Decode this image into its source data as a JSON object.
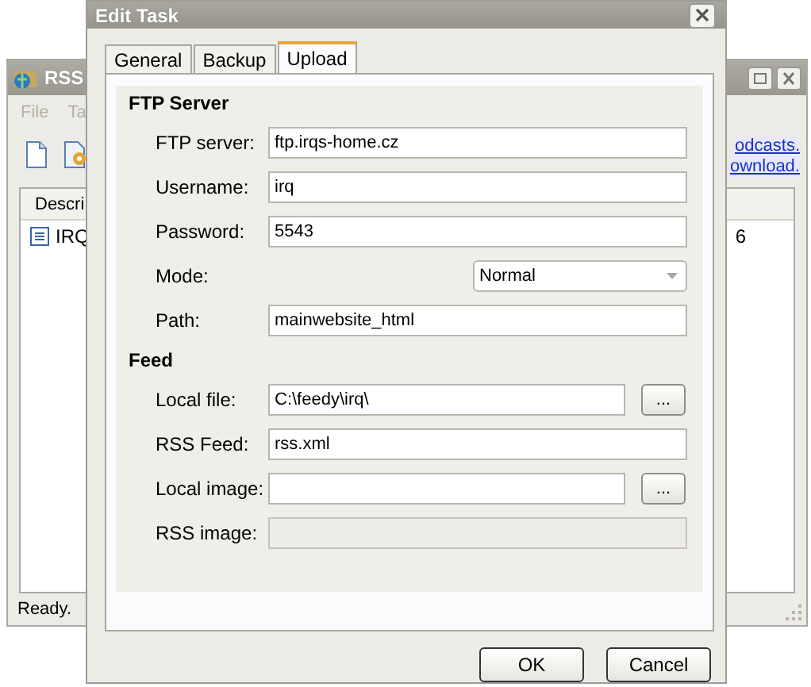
{
  "background_window": {
    "title": "RSS",
    "menu": [
      "File",
      "Ta"
    ],
    "links": [
      "odcasts.",
      "ownload."
    ],
    "columns": [
      "Descri"
    ],
    "rows": [
      {
        "column_1": "IRQ",
        "column_2": "6"
      }
    ],
    "status_bar": "Ready."
  },
  "dialog": {
    "title": "Edit Task",
    "tabs": [
      {
        "label": "General",
        "selected": false
      },
      {
        "label": "Backup",
        "selected": false
      },
      {
        "label": "Upload",
        "selected": true
      }
    ],
    "sections": [
      {
        "title": "FTP Server",
        "fields": [
          {
            "kind": "text",
            "label": "FTP server:",
            "value": "ftp.irqs-home.cz",
            "disabled": false
          },
          {
            "kind": "text",
            "label": "Username:",
            "value": "irq",
            "disabled": false
          },
          {
            "kind": "text",
            "label": "Password:",
            "value": "5543",
            "disabled": false
          },
          {
            "kind": "dropdown",
            "label": "Mode:",
            "value": "Normal",
            "disabled": false
          },
          {
            "kind": "text",
            "label": "Path:",
            "value": "mainwebsite_html",
            "disabled": false
          }
        ]
      },
      {
        "title": "Feed",
        "fields": [
          {
            "kind": "text",
            "label": "Local file:",
            "value": "C:\\feedy\\irq\\",
            "browse_button": "...",
            "disabled": false
          },
          {
            "kind": "text",
            "label": "RSS Feed:",
            "value": "rss.xml",
            "disabled": false
          },
          {
            "kind": "text",
            "label": "Local image:",
            "browse_button": "...",
            "disabled": false
          },
          {
            "kind": "text",
            "label": "RSS image:",
            "disabled": true
          }
        ]
      }
    ],
    "buttons": [
      "OK",
      "Cancel"
    ]
  }
}
